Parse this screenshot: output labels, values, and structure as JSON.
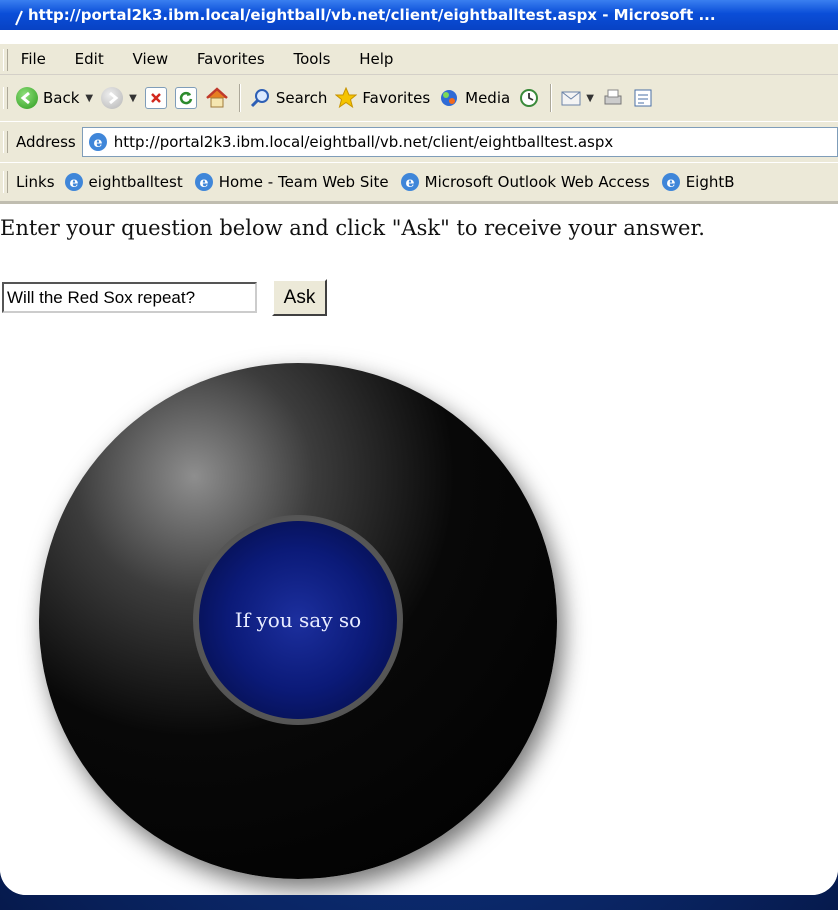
{
  "window": {
    "title": "http://portal2k3.ibm.local/eightball/vb.net/client/eightballtest.aspx - Microsoft ..."
  },
  "menu": {
    "items": [
      "File",
      "Edit",
      "View",
      "Favorites",
      "Tools",
      "Help"
    ]
  },
  "toolbar": {
    "back_label": "Back",
    "search_label": "Search",
    "favorites_label": "Favorites",
    "media_label": "Media"
  },
  "address": {
    "label": "Address",
    "url": "http://portal2k3.ibm.local/eightball/vb.net/client/eightballtest.aspx"
  },
  "links": {
    "label": "Links",
    "items": [
      "eightballtest",
      "Home - Team Web Site",
      "Microsoft Outlook Web Access",
      "EightB"
    ]
  },
  "page": {
    "instructions": "Enter your question below and click \"Ask\" to receive your answer.",
    "question_value": "Will the Red Sox repeat?",
    "ask_label": "Ask",
    "answer": "If you say so"
  },
  "colors": {
    "titlebar": "#0a4ed8",
    "chrome": "#ece9d8",
    "ball": "#000000",
    "answer_window": "#0b1a78"
  }
}
